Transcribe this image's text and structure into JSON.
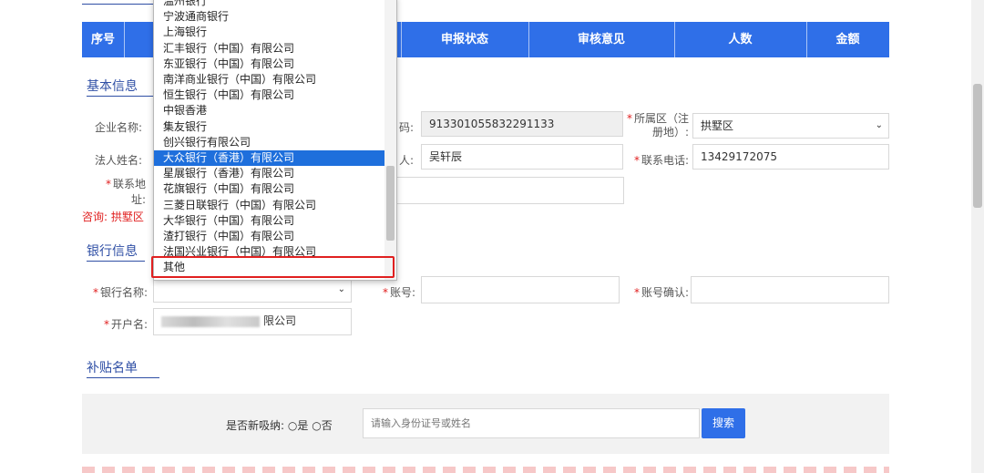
{
  "table_header": {
    "seq": "序号",
    "status": "申报状态",
    "review": "审核意见",
    "people": "人数",
    "amount": "金额"
  },
  "basic": {
    "title": "基本信息",
    "company_label": "企业名称:",
    "code_label": "码:",
    "code_value": "913301055832291133",
    "district_label": "所属区（注册地）:",
    "district_value": "拱墅区",
    "legal_label": "法人姓名:",
    "contact_label": "人:",
    "contact_value": "吴轩辰",
    "phone_label": "联系电话:",
    "phone_value": "13429172075",
    "address_label": "联系地址:",
    "notice": "咨询: 拱墅区"
  },
  "bank": {
    "title": "银行信息",
    "bank_name_label": "银行名称:",
    "account_label": "账号:",
    "account_confirm_label": "账号确认:",
    "holder_label": "开户名:",
    "holder_value": "限公司"
  },
  "subsidy": {
    "title": "补贴名单",
    "new_hire_label": "是否新吸纳:",
    "yes": "是",
    "no": "否",
    "search_placeholder": "请输入身份证号或姓名",
    "search_button": "搜索"
  },
  "dropdown": {
    "options": [
      "温州银行",
      "宁波通商银行",
      "上海银行",
      "汇丰银行（中国）有限公司",
      "东亚银行（中国）有限公司",
      "南洋商业银行（中国）有限公司",
      "恒生银行（中国）有限公司",
      "中银香港",
      "集友银行",
      "创兴银行有限公司",
      "大众银行（香港）有限公司",
      "星展银行（香港）有限公司",
      "花旗银行（中国）有限公司",
      "三菱日联银行（中国）有限公司",
      "大华银行（中国）有限公司",
      "渣打银行（中国）有限公司",
      "法国兴业银行（中国）有限公司",
      "其他"
    ],
    "selected_index": 10
  },
  "colors": {
    "primary": "#2f6fe8",
    "required": "#e02020",
    "selected": "#1e6fdc"
  }
}
